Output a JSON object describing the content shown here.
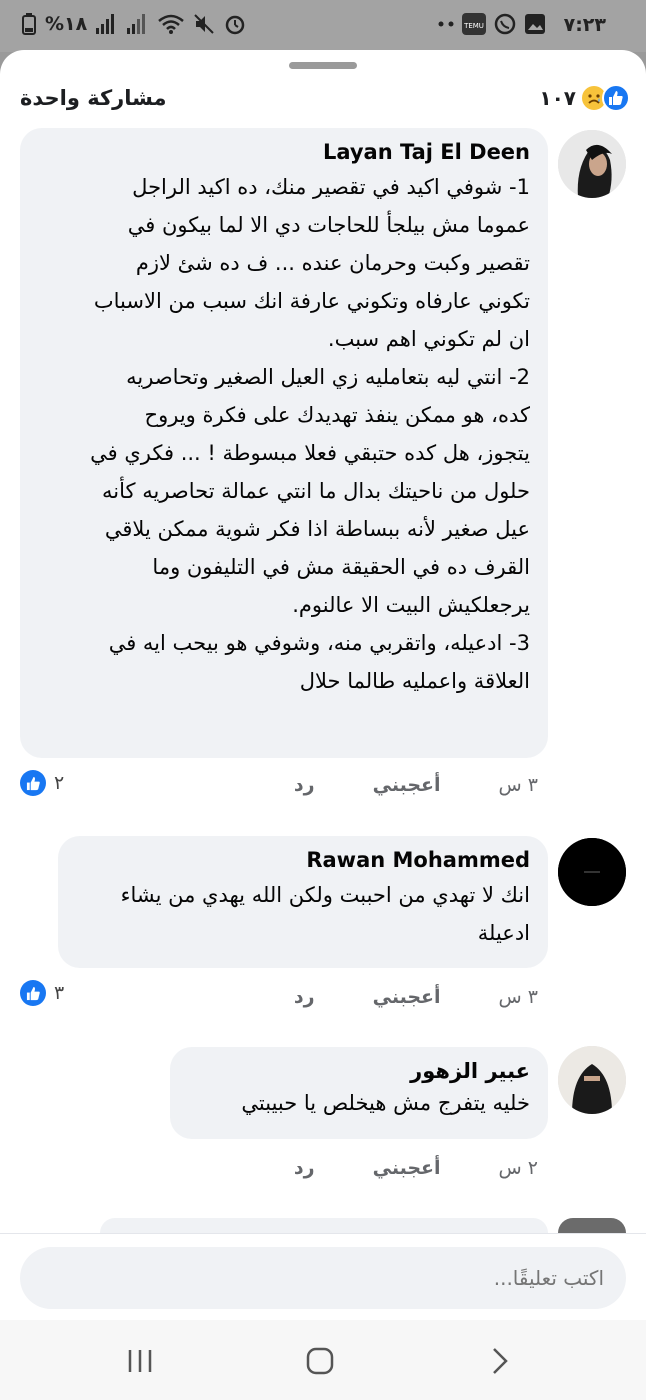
{
  "status_bar": {
    "time": "٧:٢٣",
    "battery": "%١٨",
    "right_icons": [
      "gallery-icon",
      "whatsapp-icon",
      "temu-icon",
      "dots-icon"
    ],
    "left_icons": [
      "battery-icon",
      "signal-icon",
      "signal-icon",
      "wifi-icon",
      "mute-icon",
      "alarm-icon"
    ]
  },
  "header": {
    "share_count": "مشاركة واحدة",
    "reaction_count": "١٠٧",
    "reaction_icons": [
      "like-icon",
      "sad-icon"
    ]
  },
  "comments": [
    {
      "author": "Layan Taj El Deen",
      "lines": [
        "1- شوفي اكيد في تقصير منك، ده اكيد الراجل",
        "عموما مش بيلجأ للحاجات دي الا لما بيكون في",
        "تقصير وكبت وحرمان عنده ... ف ده شئ لازم",
        "تكوني عارفاه وتكوني عارفة انك سبب من الاسباب",
        "ان لم تكوني اهم سبب.",
        "2- انتي ليه بتعامليه زي العيل الصغير وتحاصريه",
        "كده، هو ممكن ينفذ تهديدك على فكرة ويروح",
        "يتجوز، هل كده حتبقي فعلا مبسوطة ! ... فكري في",
        "حلول من ناحيتك بدال ما انتي عمالة تحاصريه كأنه",
        "عيل صغير لأنه ببساطة اذا فكر شوية ممكن يلاقي",
        "القرف ده في الحقيقة مش في التليفون وما",
        "يرجعلكيش البيت الا عالنوم.",
        "3- ادعيله، واتقربي منه، وشوفي هو بيحب ايه في",
        "العلاقة واعمليه طالما حلال"
      ],
      "time": "٣ س",
      "like_label": "أعجبني",
      "reply_label": "رد",
      "likes": "٢"
    },
    {
      "author": "Rawan Mohammed",
      "lines": [
        "انك لا تهدي من احببت ولكن الله يهدي من يشاء",
        "ادعيلة"
      ],
      "time": "٣ س",
      "like_label": "أعجبني",
      "reply_label": "رد",
      "likes": "٣"
    },
    {
      "author": "عبير الزهور",
      "lines": [
        "خليه يتفرج مش هيخلص يا حبيبتي"
      ],
      "time": "٢ س",
      "like_label": "أعجبني",
      "reply_label": "رد",
      "likes": ""
    }
  ],
  "composer": {
    "placeholder": "اكتب تعليقًا..."
  },
  "nav": {
    "buttons": [
      "recent-apps-icon",
      "home-icon",
      "back-icon"
    ]
  }
}
